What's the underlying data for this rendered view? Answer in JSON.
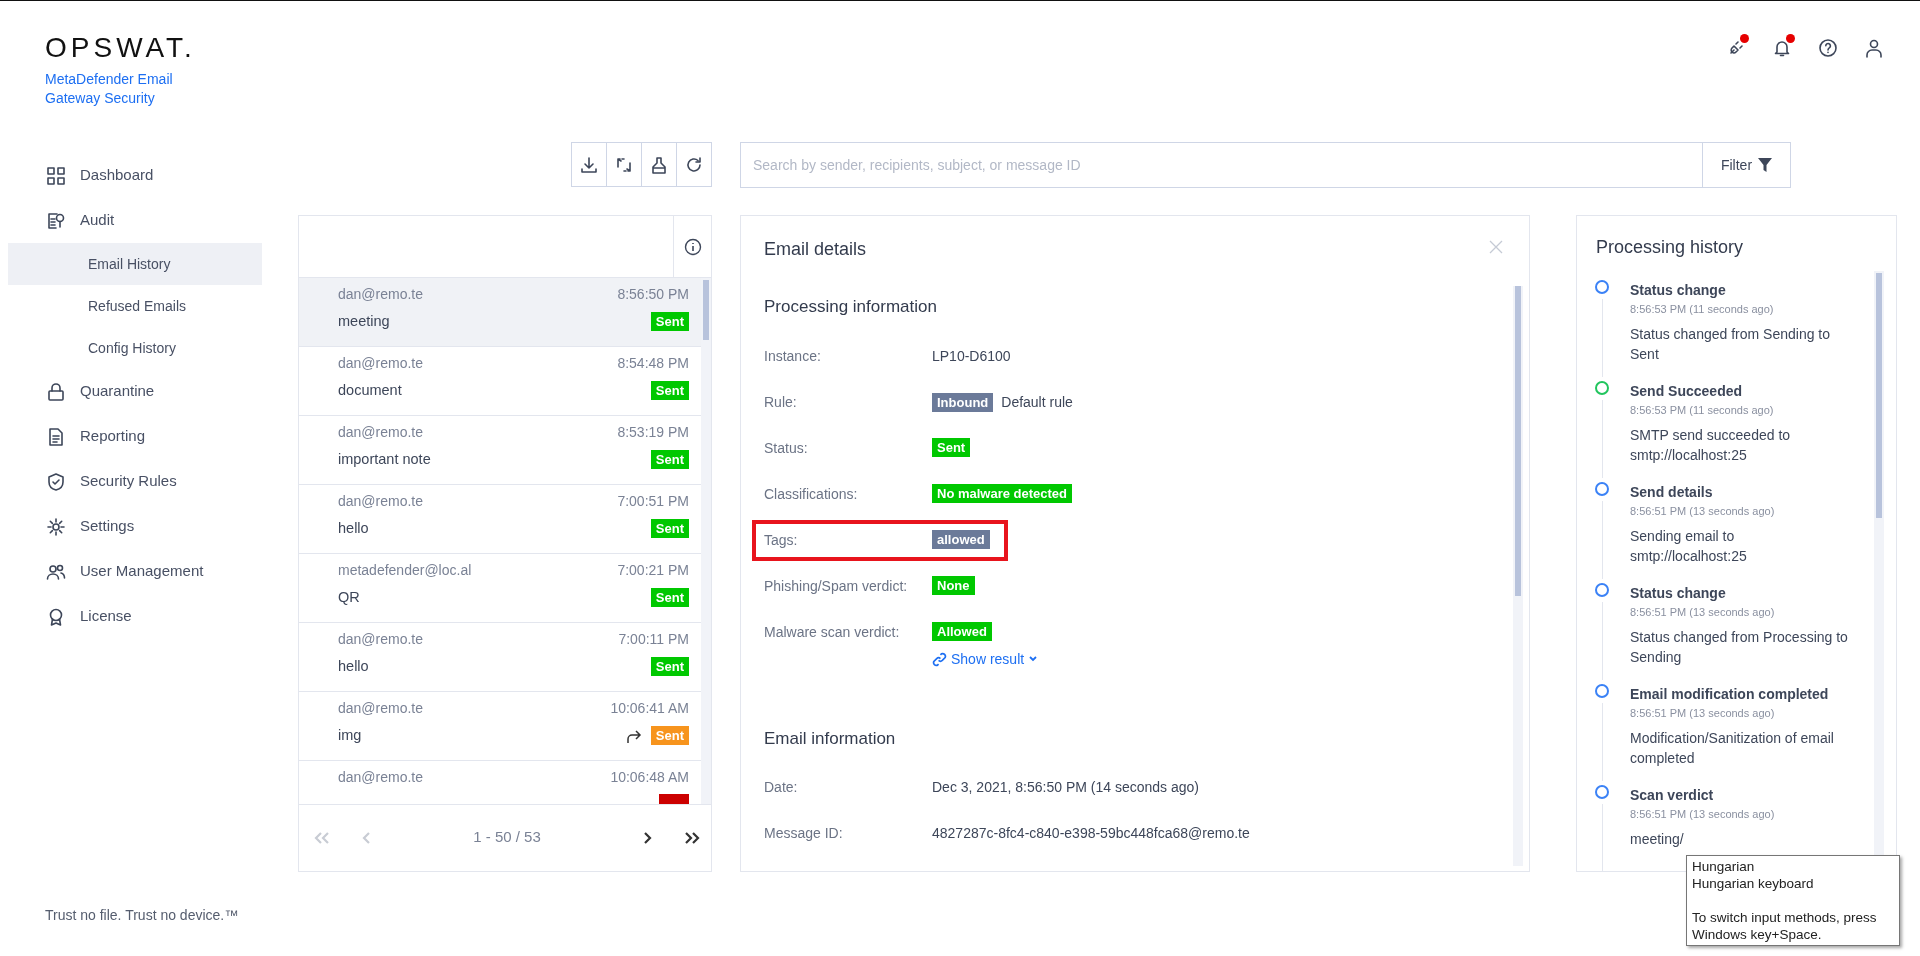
{
  "brand": {
    "logo": "OPSWAT.",
    "product": "MetaDefender Email Gateway Security"
  },
  "header_icons": [
    {
      "notification": true
    },
    {
      "notification": true
    },
    {
      "notification": false
    },
    {
      "notification": false
    }
  ],
  "sidebar": {
    "items": [
      {
        "label": "Dashboard",
        "selected": false
      },
      {
        "label": "Audit",
        "selected": false,
        "children": [
          {
            "label": "Email History",
            "selected": true
          },
          {
            "label": "Refused Emails",
            "selected": false
          },
          {
            "label": "Config History",
            "selected": false
          }
        ]
      },
      {
        "label": "Quarantine",
        "selected": false
      },
      {
        "label": "Reporting",
        "selected": false
      },
      {
        "label": "Security Rules",
        "selected": false
      },
      {
        "label": "Settings",
        "selected": false
      },
      {
        "label": "User Management",
        "selected": false
      },
      {
        "label": "License",
        "selected": false
      }
    ],
    "footer": "Trust no file. Trust no device.™"
  },
  "search": {
    "placeholder": "Search by sender, recipients, subject, or message ID",
    "filter_label": "Filter"
  },
  "email_list": {
    "rows": [
      {
        "sender": "dan@remo.te",
        "time": "8:56:50 PM",
        "subject": "meeting",
        "status": "Sent",
        "color": "#00c800",
        "forwarded": false,
        "selected": true
      },
      {
        "sender": "dan@remo.te",
        "time": "8:54:48 PM",
        "subject": "document",
        "status": "Sent",
        "color": "#00c800",
        "forwarded": false,
        "selected": false
      },
      {
        "sender": "dan@remo.te",
        "time": "8:53:19 PM",
        "subject": "important note",
        "status": "Sent",
        "color": "#00c800",
        "forwarded": false,
        "selected": false
      },
      {
        "sender": "dan@remo.te",
        "time": "7:00:51 PM",
        "subject": "hello",
        "status": "Sent",
        "color": "#00c800",
        "forwarded": false,
        "selected": false
      },
      {
        "sender": "metadefender@loc.al",
        "time": "7:00:21 PM",
        "subject": "QR",
        "status": "Sent",
        "color": "#00c800",
        "forwarded": false,
        "selected": false
      },
      {
        "sender": "dan@remo.te",
        "time": "7:00:11 PM",
        "subject": "hello",
        "status": "Sent",
        "color": "#00c800",
        "forwarded": false,
        "selected": false
      },
      {
        "sender": "dan@remo.te",
        "time": "10:06:41 AM",
        "subject": "img",
        "status": "Sent",
        "color": "#f7941d",
        "forwarded": true,
        "selected": false
      },
      {
        "sender": "dan@remo.te",
        "time": "10:06:48 AM",
        "color": "#cc0000",
        "selected": false
      }
    ],
    "pagination": "1 - 50 / 53"
  },
  "email_details": {
    "title": "Email details",
    "sections": [
      {
        "heading": "Processing information",
        "fields": [
          {
            "label": "Instance:",
            "kind": "text",
            "value": "LP10-D6100",
            "highlighted": false
          },
          {
            "label": "Rule:",
            "kind": "rule",
            "badge": "Inbound",
            "value": "Default rule",
            "highlighted": false
          },
          {
            "label": "Status:",
            "kind": "badge",
            "badge": "Sent",
            "color": "#00c800",
            "highlighted": false
          },
          {
            "label": "Classifications:",
            "kind": "badge",
            "badge": "No malware detected",
            "color": "#00c800",
            "highlighted": false
          },
          {
            "label": "Tags:",
            "kind": "badge",
            "badge": "allowed",
            "color": "#6b7a99",
            "highlighted": true
          },
          {
            "label": "Phishing/Spam verdict:",
            "kind": "badge",
            "badge": "None",
            "color": "#00c800",
            "highlighted": false
          },
          {
            "label": "Malware scan verdict:",
            "kind": "badge",
            "badge": "Allowed",
            "color": "#00c800",
            "link": "Show result",
            "highlighted": false
          }
        ]
      },
      {
        "heading": "Email information",
        "fields": [
          {
            "label": "Date:",
            "kind": "text",
            "value": "Dec 3, 2021, 8:56:50 PM (14 seconds ago)",
            "highlighted": false
          },
          {
            "label": "Message ID:",
            "kind": "text",
            "value": "4827287c-8fc4-c840-e398-59bc448fca68@remo.te",
            "highlighted": false
          }
        ]
      }
    ]
  },
  "processing_history": {
    "title": "Processing history",
    "events": [
      {
        "title": "Status change",
        "time": "8:56:53 PM (11 seconds ago)",
        "description": "Status changed from Sending to Sent",
        "color": "#3b82f6"
      },
      {
        "title": "Send Succeeded",
        "time": "8:56:53 PM (11 seconds ago)",
        "description": "SMTP send succeeded to smtp://localhost:25",
        "color": "#22c55e"
      },
      {
        "title": "Send details",
        "time": "8:56:51 PM (13 seconds ago)",
        "description": "Sending email to smtp://localhost:25",
        "color": "#3b82f6"
      },
      {
        "title": "Status change",
        "time": "8:56:51 PM (13 seconds ago)",
        "description": "Status changed from Processing to Sending",
        "color": "#3b82f6"
      },
      {
        "title": "Email modification completed",
        "time": "8:56:51 PM (13 seconds ago)",
        "description": "Modification/Sanitization of email completed",
        "color": "#3b82f6"
      },
      {
        "title": "Scan verdict",
        "time": "8:56:51 PM (13 seconds ago)",
        "description": "meeting/",
        "color": "#3b82f6"
      }
    ]
  },
  "tooltip": {
    "title": "Hungarian",
    "subtitle": "Hungarian keyboard",
    "hint": "To switch input methods, press Windows key+Space."
  }
}
